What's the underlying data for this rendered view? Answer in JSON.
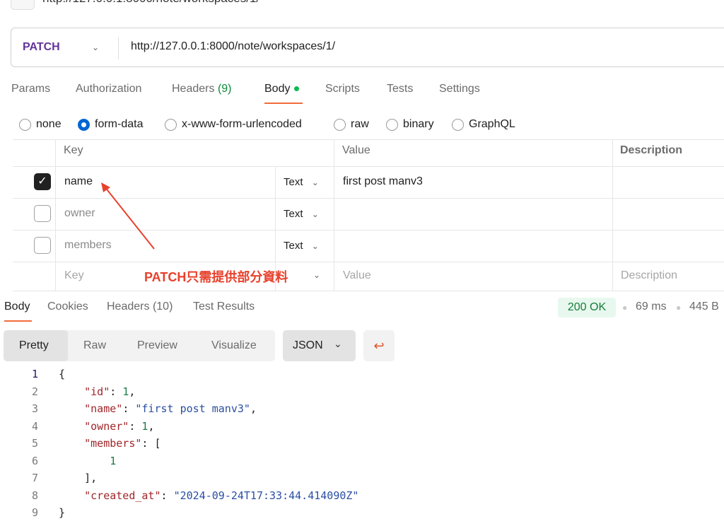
{
  "tab_title": "http://127.0.0.1:8000/note/workspaces/1/",
  "request": {
    "method": "PATCH",
    "url": "http://127.0.0.1:8000/note/workspaces/1/"
  },
  "req_tabs": [
    {
      "label": "Params"
    },
    {
      "label": "Authorization"
    },
    {
      "label": "Headers",
      "count": "(9)"
    },
    {
      "label": "Body"
    },
    {
      "label": "Scripts"
    },
    {
      "label": "Tests"
    },
    {
      "label": "Settings"
    }
  ],
  "body_types": [
    {
      "label": "none"
    },
    {
      "label": "form-data",
      "selected": true
    },
    {
      "label": "x-www-form-urlencoded"
    },
    {
      "label": "raw"
    },
    {
      "label": "binary"
    },
    {
      "label": "GraphQL"
    }
  ],
  "table": {
    "headers": {
      "key": "Key",
      "value": "Value",
      "description": "Description"
    },
    "rows": [
      {
        "checked": true,
        "key": "name",
        "type": "Text",
        "value": "first post manv3"
      },
      {
        "checked": false,
        "key": "owner",
        "type": "Text",
        "value": ""
      },
      {
        "checked": false,
        "key": "members",
        "type": "Text",
        "value": ""
      }
    ],
    "placeholder": {
      "key": "Key",
      "value": "Value",
      "description": "Description"
    }
  },
  "annotation": "PATCH只需提供部分資料",
  "resp_tabs": [
    {
      "label": "Body"
    },
    {
      "label": "Cookies"
    },
    {
      "label": "Headers",
      "count": "(10)"
    },
    {
      "label": "Test Results"
    }
  ],
  "status": {
    "code": "200 OK",
    "time": "69 ms",
    "size": "445 B",
    "color": "#167d3a"
  },
  "view_modes": [
    "Pretty",
    "Raw",
    "Preview",
    "Visualize"
  ],
  "format": "JSON",
  "accent": "#f26b3a",
  "code_lines": [
    "{",
    "    \"id\": 1,",
    "    \"name\": \"first post manv3\",",
    "    \"owner\": 1,",
    "    \"members\": [",
    "        1",
    "    ],",
    "    \"created_at\": \"2024-09-24T17:33:44.414090Z\"",
    "}"
  ]
}
